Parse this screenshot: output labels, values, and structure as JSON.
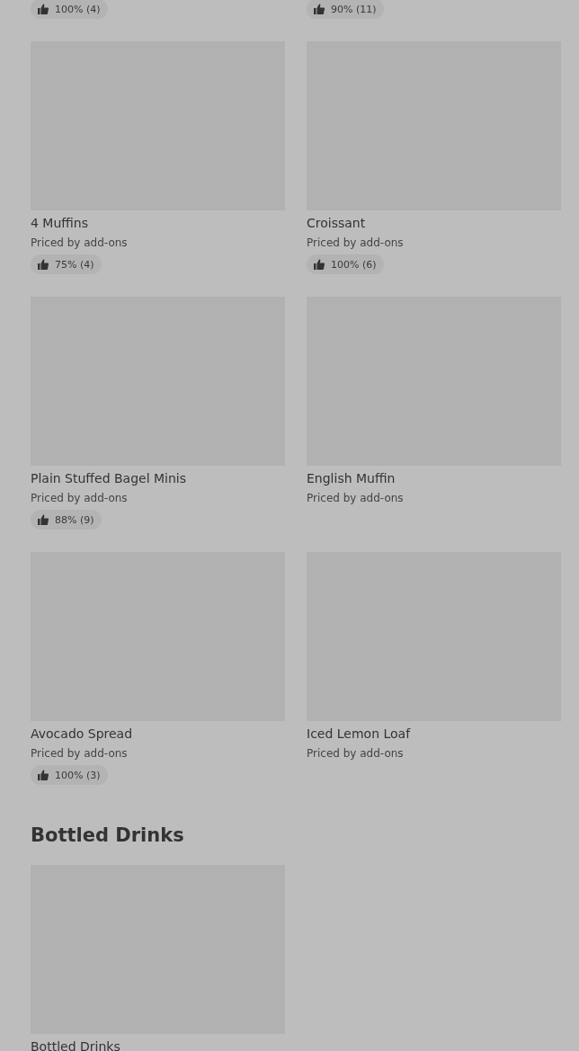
{
  "top_ratings": [
    {
      "rating": "100% (4)"
    },
    {
      "rating": "90% (11)"
    }
  ],
  "items": [
    {
      "name": "4 Muffins",
      "subtitle": "Priced by add-ons",
      "rating": "75% (4)"
    },
    {
      "name": "Croissant",
      "subtitle": "Priced by add-ons",
      "rating": "100% (6)"
    },
    {
      "name": "Plain Stuffed Bagel Minis",
      "subtitle": "Priced by add-ons",
      "rating": "88% (9)"
    },
    {
      "name": "English Muffin",
      "subtitle": "Priced by add-ons"
    },
    {
      "name": "Avocado Spread",
      "subtitle": "Priced by add-ons",
      "rating": "100% (3)"
    },
    {
      "name": "Iced Lemon Loaf",
      "subtitle": "Priced by add-ons"
    }
  ],
  "section": {
    "title": "Bottled Drinks",
    "items": [
      {
        "name": "Bottled Drinks"
      }
    ]
  }
}
